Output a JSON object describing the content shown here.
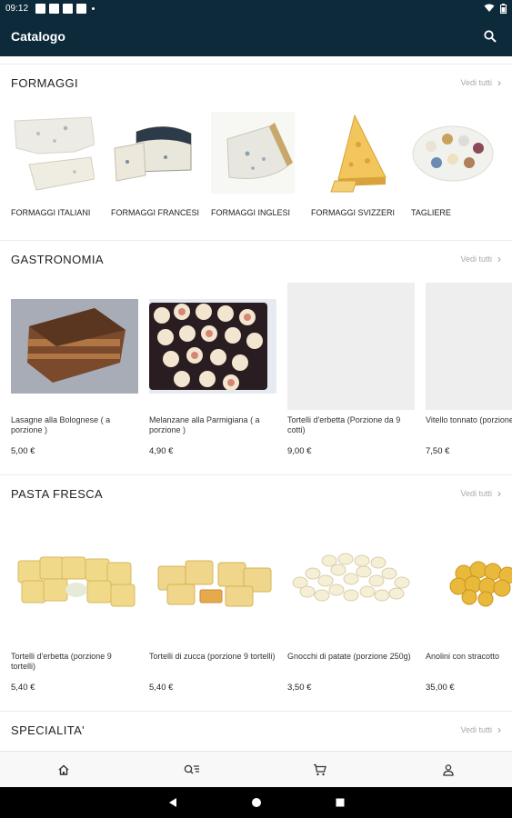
{
  "status_bar": {
    "time": "09:12"
  },
  "app_bar": {
    "title": "Catalogo"
  },
  "sections": [
    {
      "title": "FORMAGGI",
      "see_all": "Vedi tutti",
      "categories": [
        {
          "label": "FORMAGGI ITALIANI"
        },
        {
          "label": "FORMAGGI FRANCESI"
        },
        {
          "label": "FORMAGGI INGLESI"
        },
        {
          "label": "FORMAGGI SVIZZERI"
        },
        {
          "label": "TAGLIERE"
        }
      ]
    },
    {
      "title": "GASTRONOMIA",
      "see_all": "Vedi tutti",
      "products": [
        {
          "name": "Lasagne alla Bolognese ( a porzione )",
          "price": "5,00 €"
        },
        {
          "name": "Melanzane alla Parmigiana ( a porzione )",
          "price": "4,90 €"
        },
        {
          "name": "Tortelli d'erbetta (Porzione da 9 cotti)",
          "price": "9,00 €"
        },
        {
          "name": "Vitello tonnato (porzione",
          "price": "7,50 €"
        }
      ]
    },
    {
      "title": "PASTA FRESCA",
      "see_all": "Vedi tutti",
      "products": [
        {
          "name": "Tortelli d'erbetta (porzione 9 tortelli)",
          "price": "5,40 €"
        },
        {
          "name": "Tortelli di zucca (porzione 9 tortelli)",
          "price": "5,40 €"
        },
        {
          "name": "Gnocchi di patate (porzione 250g)",
          "price": "3,50 €"
        },
        {
          "name": "Anolini con stracotto",
          "price": "35,00 €"
        }
      ]
    },
    {
      "title": "SPECIALITA'",
      "see_all": "Vedi tutti"
    }
  ],
  "bottom_nav": [
    "home-icon",
    "search-list-icon",
    "cart-icon",
    "account-icon"
  ]
}
